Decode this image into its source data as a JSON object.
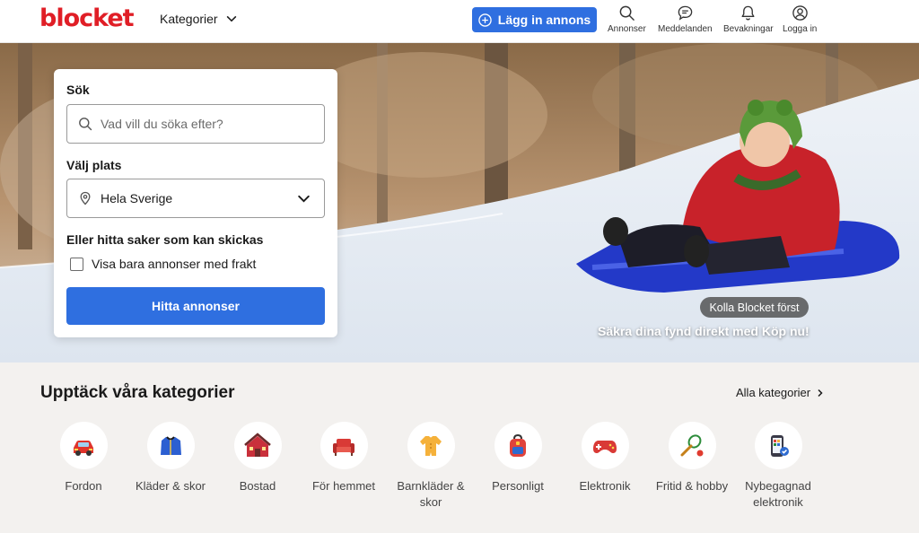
{
  "header": {
    "logo": "blocket",
    "categories_label": "Kategorier",
    "post_button": "Lägg in annons",
    "nav": [
      {
        "label": "Annonser",
        "icon": "search-icon"
      },
      {
        "label": "Meddelanden",
        "icon": "chat-icon"
      },
      {
        "label": "Bevakningar",
        "icon": "bell-icon"
      },
      {
        "label": "Logga in",
        "icon": "user-icon"
      }
    ]
  },
  "search": {
    "search_label": "Sök",
    "search_placeholder": "Vad vill du söka efter?",
    "location_label": "Välj plats",
    "location_value": "Hela Sverige",
    "shipping_label": "Eller hitta saker som kan skickas",
    "shipping_checkbox": "Visa bara annonser med frakt",
    "submit": "Hitta annonser"
  },
  "promo": {
    "badge": "Kolla Blocket först",
    "text": "Säkra dina fynd direkt med Köp nu!"
  },
  "categories": {
    "title": "Upptäck våra kategorier",
    "all_link": "Alla kategorier",
    "items": [
      {
        "label": "Fordon",
        "icon": "car-icon"
      },
      {
        "label": "Kläder & skor",
        "icon": "jacket-icon"
      },
      {
        "label": "Bostad",
        "icon": "house-icon"
      },
      {
        "label": "För hemmet",
        "icon": "armchair-icon"
      },
      {
        "label": "Barnkläder & skor",
        "icon": "onesie-icon"
      },
      {
        "label": "Personligt",
        "icon": "backpack-icon"
      },
      {
        "label": "Elektronik",
        "icon": "gamepad-icon"
      },
      {
        "label": "Fritid & hobby",
        "icon": "racket-icon"
      },
      {
        "label": "Nybegagnad elektronik",
        "icon": "phone-icon"
      }
    ]
  },
  "colors": {
    "brand": "#e01e26",
    "primary": "#2f6fe0"
  }
}
